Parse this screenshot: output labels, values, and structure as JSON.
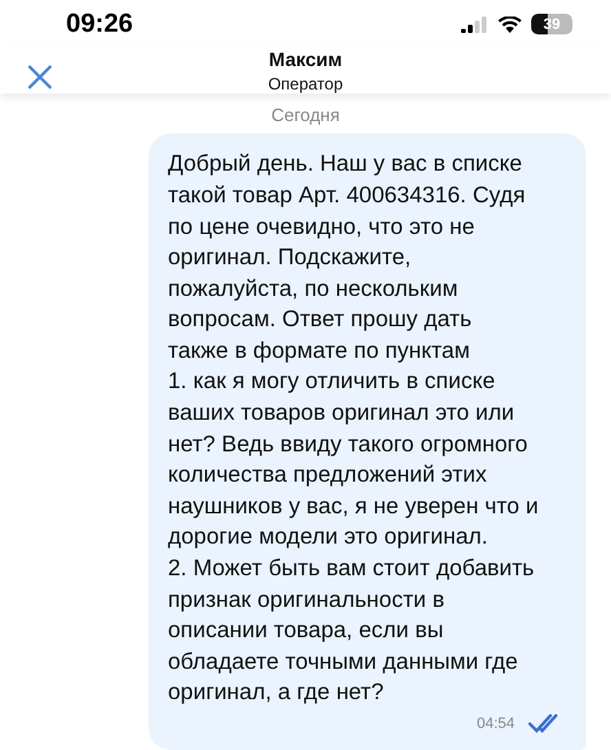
{
  "status_bar": {
    "time": "09:26",
    "battery": "39"
  },
  "header": {
    "title": "Максим",
    "subtitle": "Оператор"
  },
  "date_divider": "Сегодня",
  "messages": [
    {
      "text": "Добрый день. Наш у вас в списке\nтакой товар Арт. 400634316. Судя\nпо цене очевидно, что это не\nоригинал. Подскажите,\nпожалуйста, по нескольким\nвопросам. Ответ прошу дать\nтакже в формате по пунктам\n1. как я могу отличить в списке\nваших товаров оригинал это или\nнет? Ведь ввиду такого огромного\nколичества предложений этих\nнаушников у вас, я не уверен что и\nдорогие модели это оригинал.\n2. Может быть вам стоит добавить\nпризнак оригинальности в\nописании товара, если вы\nобладаете точными данными где\nоригинал, а где нет?",
      "time": "04:54",
      "read": true
    }
  ]
}
